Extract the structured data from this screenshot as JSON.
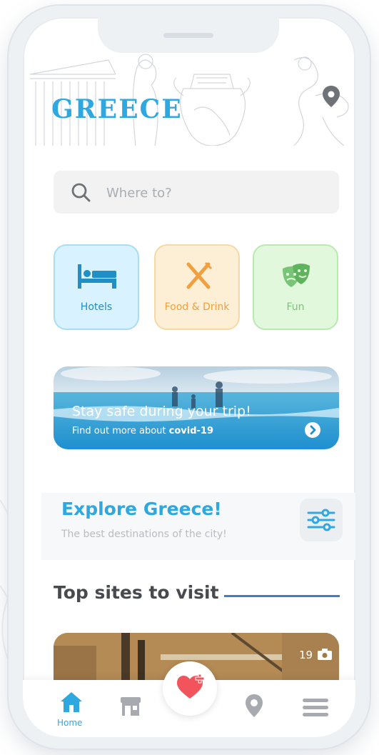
{
  "header": {
    "title": "GREECE"
  },
  "search": {
    "placeholder": "Where to?"
  },
  "categories": [
    {
      "label": "Hotels"
    },
    {
      "label": "Food & Drink"
    },
    {
      "label": "Fun"
    }
  ],
  "banner": {
    "title": "Stay safe during your trip!",
    "subtitle_prefix": "Find out more about ",
    "subtitle_bold": "covid-19"
  },
  "explore": {
    "title": "Explore Greece!",
    "subtitle": "The best destinations of the city!"
  },
  "top_sites": {
    "title": "Top sites to visit",
    "card": {
      "photo_count": "19"
    }
  },
  "nav": {
    "home_label": "Home"
  },
  "colors": {
    "accent": "#2fa8e0",
    "hotels": "#d8f2ff",
    "food": "#fdefd6",
    "fun": "#e2f8dd",
    "heart": "#f2545b",
    "line": "#3e7fc4"
  }
}
